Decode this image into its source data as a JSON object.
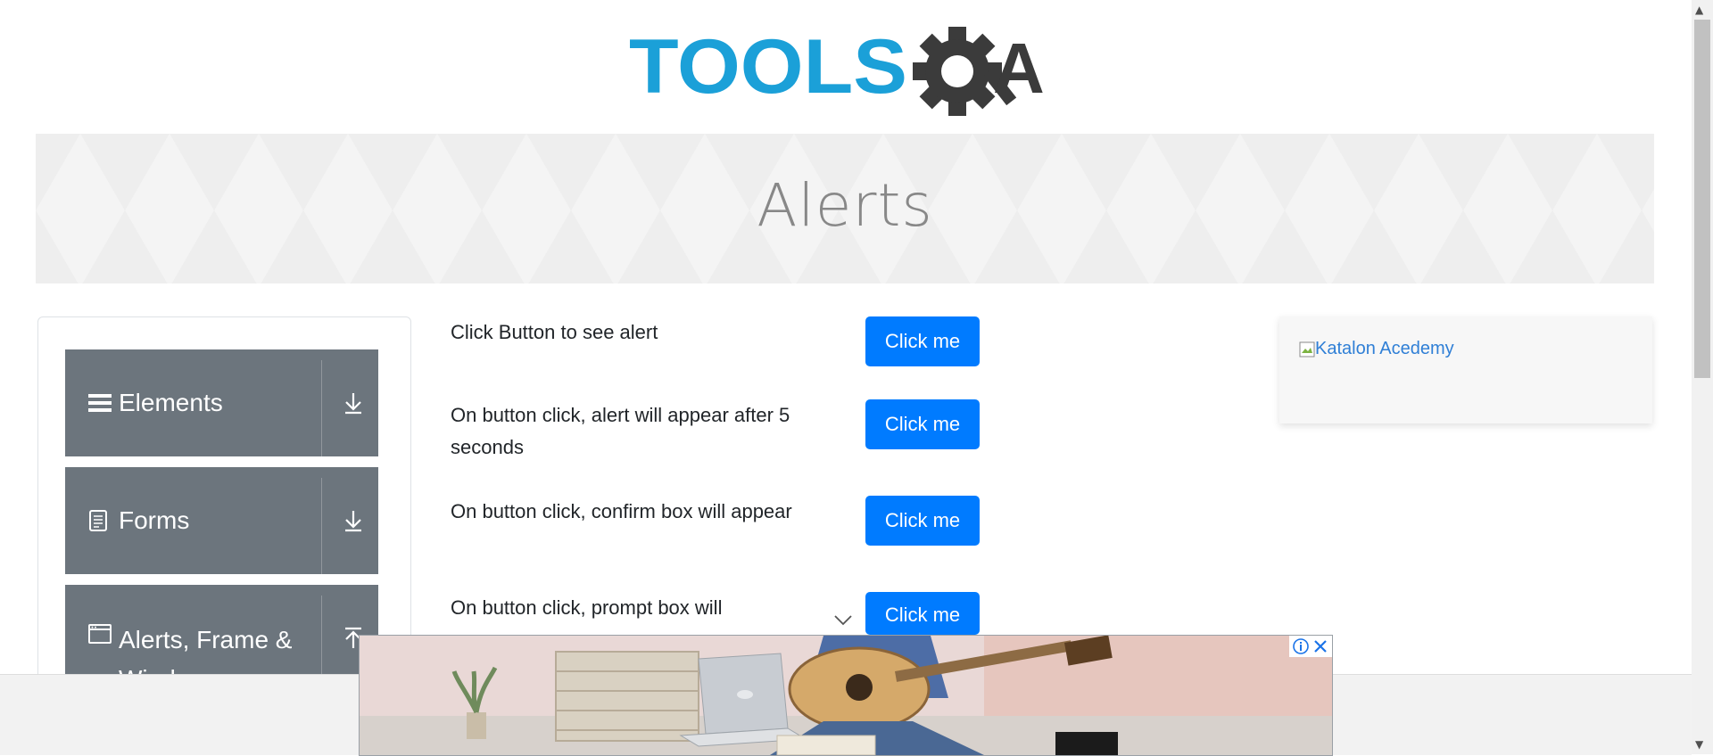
{
  "header": {
    "logo": {
      "tools": "TOOLS",
      "qa": "A"
    },
    "page_title": "Alerts"
  },
  "sidebar": {
    "groups": [
      {
        "label": "Elements",
        "icon": "hamburger-icon",
        "toggle": "download-arrow-icon"
      },
      {
        "label": "Forms",
        "icon": "document-icon",
        "toggle": "download-arrow-icon"
      },
      {
        "label": "Alerts, Frame & Windows",
        "icon": "window-icon",
        "toggle": "upload-arrow-icon"
      }
    ]
  },
  "main": {
    "rows": [
      {
        "text": "Click Button to see alert",
        "button": "Click me"
      },
      {
        "text": "On button click, alert will appear after 5 seconds",
        "button": "Click me"
      },
      {
        "text": "On button click, confirm box will appear",
        "button": "Click me"
      },
      {
        "text": "On button click, prompt box will",
        "button": "Click me"
      }
    ]
  },
  "ad_card": {
    "alt_text": "Katalon Acedemy"
  },
  "colors": {
    "primary_button": "#007bff",
    "sidebar_group": "#6c757d",
    "logo_blue": "#1ba0d8",
    "logo_dark": "#3b3b3b",
    "link": "#2f7fd6"
  }
}
